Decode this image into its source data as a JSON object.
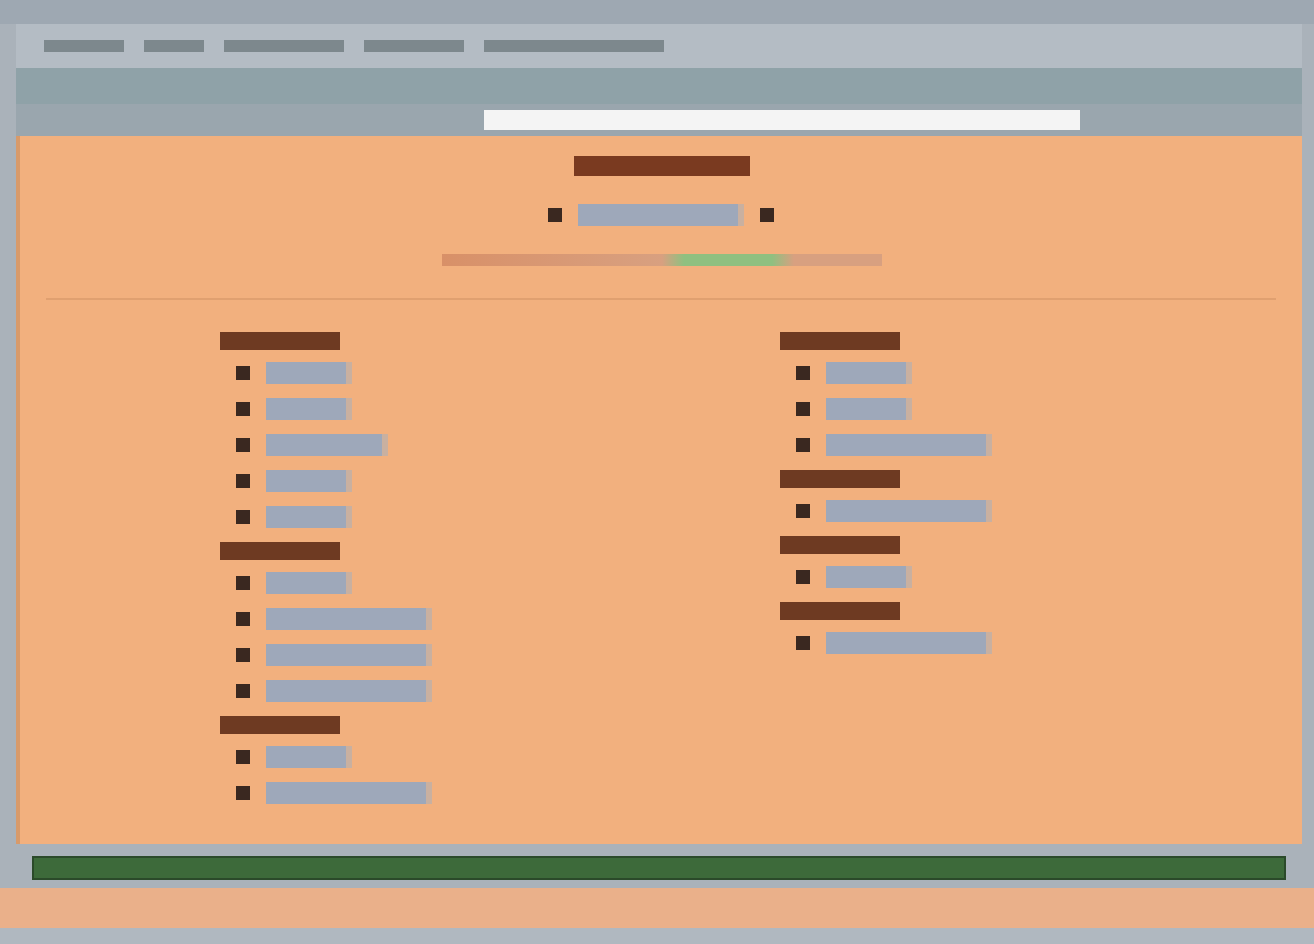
{
  "header": {
    "links": [
      {
        "kind": "long"
      }
    ]
  },
  "columns": [
    {
      "groups": [
        {
          "items": [
            {
              "kind": "short"
            },
            {
              "kind": "short"
            },
            {
              "kind": "medium"
            },
            {
              "kind": "short"
            },
            {
              "kind": "short"
            }
          ]
        },
        {
          "items": [
            {
              "kind": "short"
            },
            {
              "kind": "long"
            },
            {
              "kind": "long"
            },
            {
              "kind": "long"
            }
          ]
        },
        {
          "items": [
            {
              "kind": "short"
            },
            {
              "kind": "long"
            }
          ]
        }
      ]
    },
    {
      "groups": [
        {
          "items": [
            {
              "kind": "short"
            },
            {
              "kind": "short"
            },
            {
              "kind": "long"
            }
          ]
        },
        {
          "items": [
            {
              "kind": "long"
            }
          ]
        },
        {
          "items": [
            {
              "kind": "short"
            }
          ]
        },
        {
          "items": [
            {
              "kind": "long"
            }
          ]
        }
      ]
    }
  ]
}
